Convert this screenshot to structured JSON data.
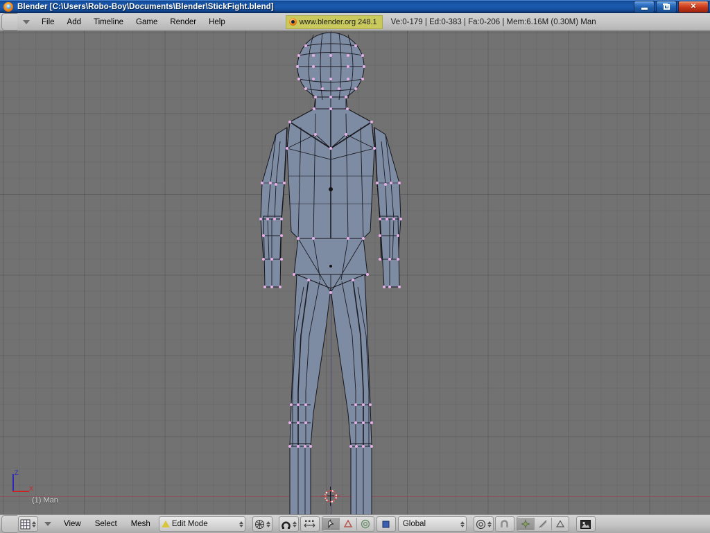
{
  "window": {
    "title": "Blender [C:\\Users\\Robo-Boy\\Documents\\Blender\\StickFight.blend]",
    "logo_icon": "blender-logo-icon",
    "minimize_icon": "minimize-icon",
    "maximize_icon": "restore-icon",
    "close_icon": "close-icon",
    "titlebar_color": "#1b5bb0",
    "close_color": "#c8381a"
  },
  "header": {
    "pulldown_icon": "menu-pulldown-icon",
    "menus": [
      {
        "label": "File"
      },
      {
        "label": "Add"
      },
      {
        "label": "Timeline"
      },
      {
        "label": "Game"
      },
      {
        "label": "Render"
      },
      {
        "label": "Help"
      }
    ],
    "version_badge": {
      "icon": "blender-logo-icon",
      "label": "www.blender.org 248.1",
      "bg_color": "#c9c95e"
    },
    "stats": "Ve:0-179 | Ed:0-383 | Fa:0-206 | Mem:6.16M (0.30M) Man",
    "stats_parts": {
      "vertices": "Ve:0-179",
      "edges": "Ed:0-383",
      "faces": "Fa:0-206",
      "memory": "Mem:6.16M (0.30M)",
      "object": "Man"
    }
  },
  "viewport": {
    "background_color": "#727272",
    "grid_color": "#696969",
    "x_axis_color": "#8a5560",
    "z_axis_color": "#4a4a6e",
    "mesh_face_color": "#7d8ba3",
    "mesh_edge_color": "#16161c",
    "mesh_vertex_color": "#e8b0e8",
    "object_label": "(1) Man",
    "cursor_icon": "3d-cursor-icon",
    "gizmo": {
      "z_label": "Z",
      "x_label": "X",
      "z_color": "#2b2bbb",
      "x_color": "#cc2222"
    }
  },
  "footer": {
    "pulldown_icon": "menu-pulldown-icon",
    "editor_type_icon": "3d-view-editor-icon",
    "menus": [
      {
        "label": "View"
      },
      {
        "label": "Select"
      },
      {
        "label": "Mesh"
      }
    ],
    "mode_dropdown": {
      "label": "Edit Mode",
      "icon": "edit-mode-triangle-icon"
    },
    "shading_dropdown": {
      "icon": "viewport-shading-icon"
    },
    "occlude_button": {
      "icon": "occlude-background-geometry-icon"
    },
    "limit_selection_button": {
      "icon": "limit-selection-to-visible-icon"
    },
    "select_modes": [
      {
        "icon": "vertex-select-mode-icon",
        "selected": true
      },
      {
        "icon": "edge-select-mode-icon",
        "selected": false
      },
      {
        "icon": "face-select-mode-icon",
        "selected": false
      }
    ],
    "orientation_dropdown": {
      "label": "Global"
    },
    "pivot_dropdown": {
      "icon": "pivot-median-point-icon"
    },
    "snap_button": {
      "icon": "snap-magnet-icon"
    },
    "proportional_modes": [
      {
        "icon": "proportional-editing-icon",
        "selected": true
      },
      {
        "icon": "mesh-noise-icon",
        "selected": false
      },
      {
        "icon": "render-face-icon",
        "selected": false
      }
    ],
    "render_button": {
      "icon": "render-preview-icon"
    }
  }
}
